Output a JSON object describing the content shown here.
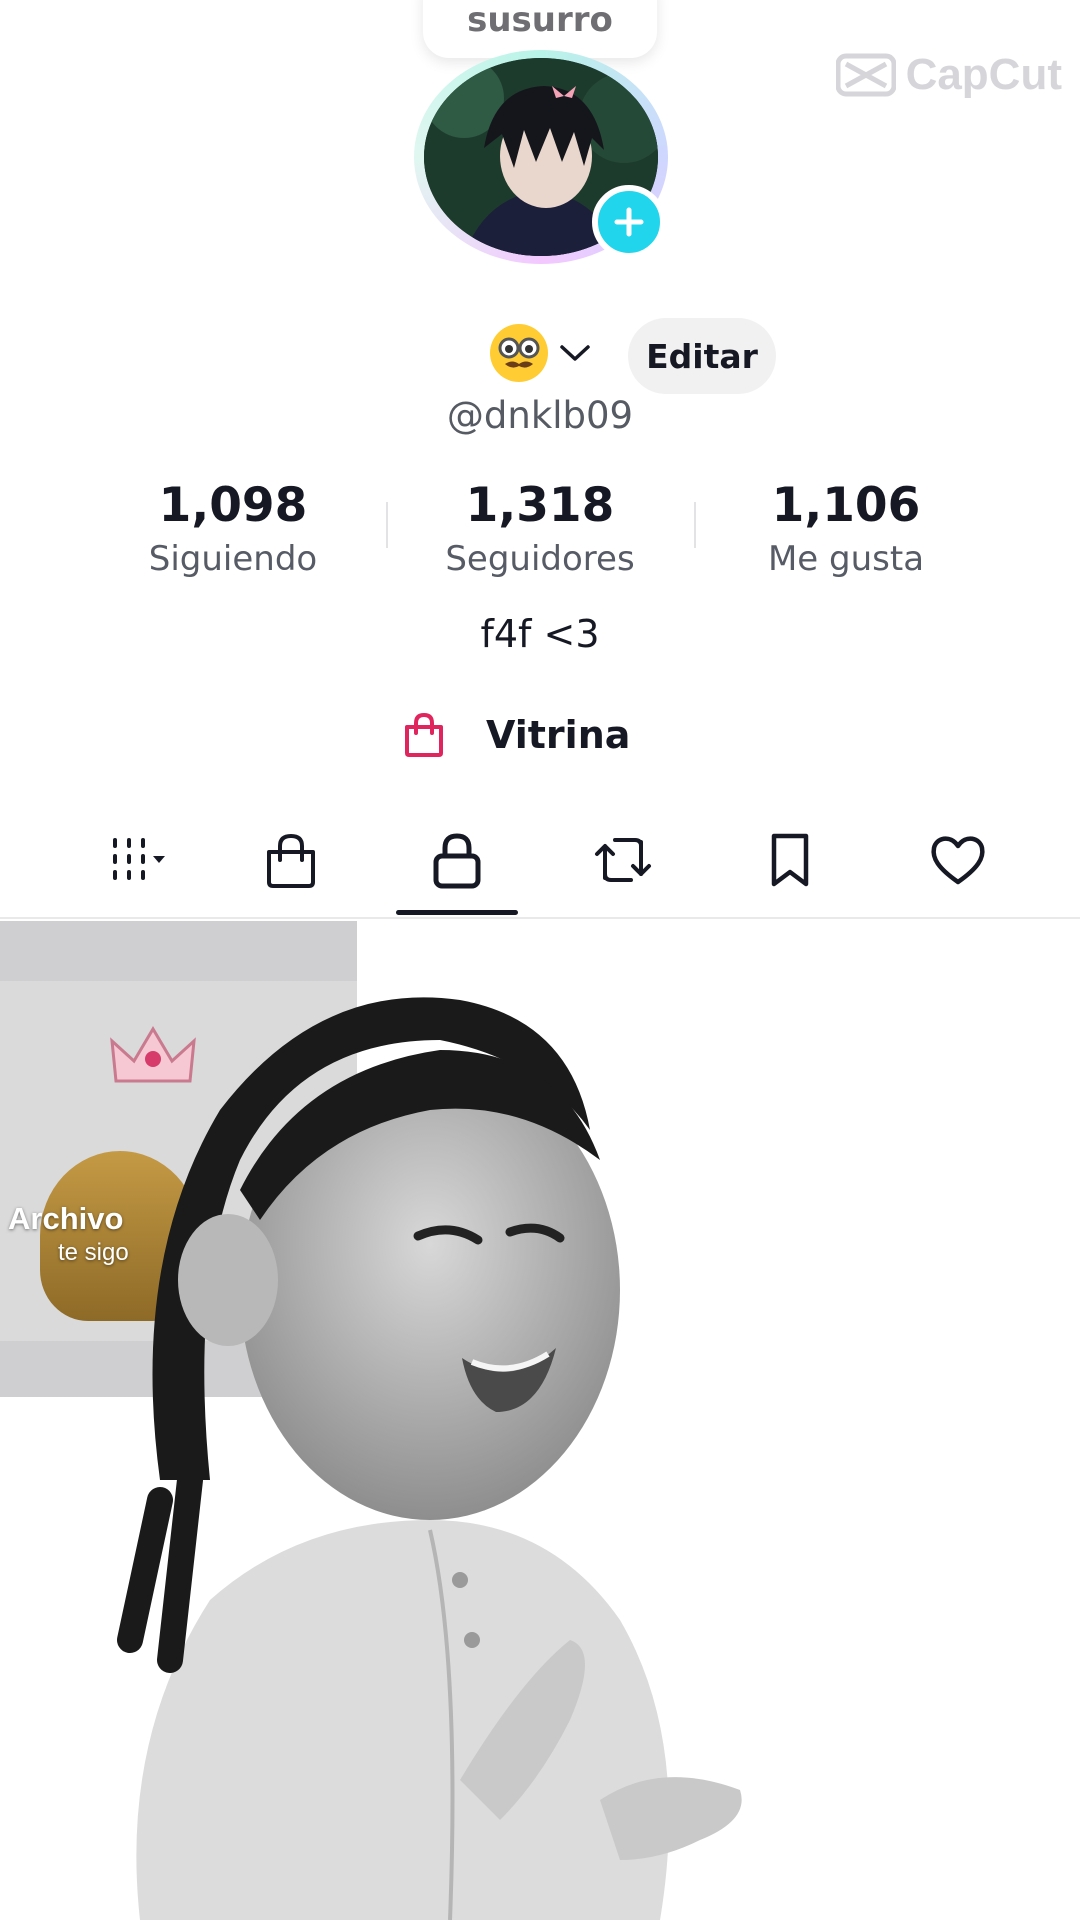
{
  "watermark": {
    "text": "CapCut"
  },
  "story": {
    "bubble_text": "susurro"
  },
  "profile": {
    "emoji_icon": "monocle-face-emoji",
    "edit_label": "Editar",
    "username": "@dnklb09",
    "bio": "f4f <3"
  },
  "stats": [
    {
      "value": "1,098",
      "label": "Siguiendo"
    },
    {
      "value": "1,318",
      "label": "Seguidores"
    },
    {
      "value": "1,106",
      "label": "Me gusta"
    }
  ],
  "showcase": {
    "label": "Vitrina",
    "icon": "shopping-bag-icon",
    "color": "#e0245e"
  },
  "tabs": [
    {
      "icon": "grid-icon",
      "active": false
    },
    {
      "icon": "shopping-bag-icon",
      "active": false
    },
    {
      "icon": "lock-icon",
      "active": true
    },
    {
      "icon": "repost-icon",
      "active": false
    },
    {
      "icon": "bookmark-icon",
      "active": false
    },
    {
      "icon": "heart-icon",
      "active": false
    }
  ],
  "tile": {
    "title": "Archivo",
    "subtitle": "te sigo"
  },
  "colors": {
    "accent": "#20d5ec",
    "text": "#161823"
  }
}
